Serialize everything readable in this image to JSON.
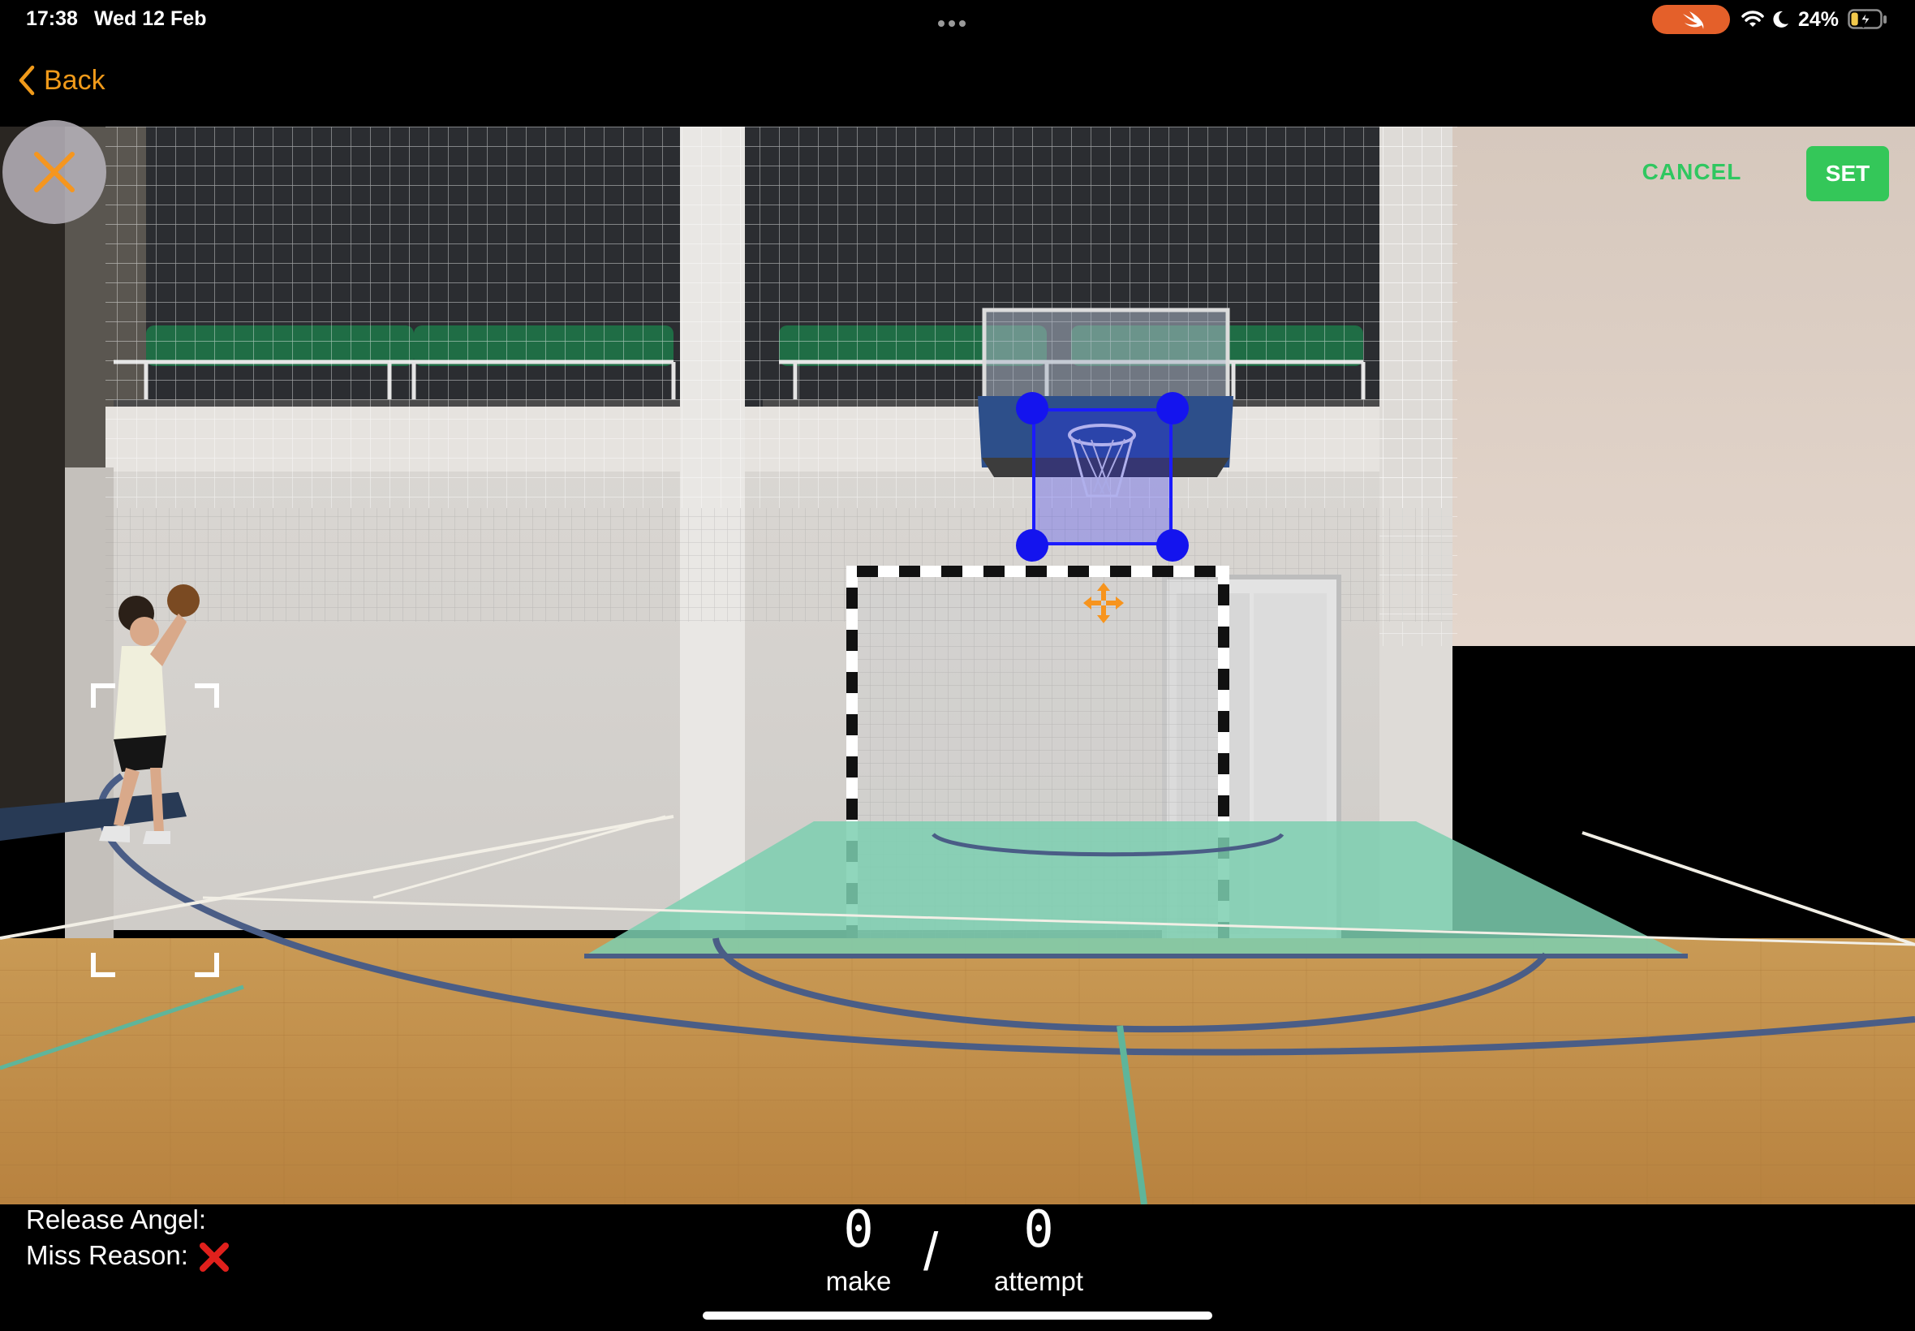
{
  "status_bar": {
    "time": "17:38",
    "date": "Wed 12 Feb",
    "battery_percent": "24%",
    "battery_level": 0.24,
    "charging": true,
    "swift_pill_color": "#e4602a"
  },
  "nav": {
    "back_label": "Back",
    "accent_color": "#f09a1a"
  },
  "overlay": {
    "cancel_label": "CANCEL",
    "set_label": "SET",
    "set_color": "#34c759",
    "hoop_box_color": "#1b1bff"
  },
  "stats": {
    "release_angle_label": "Release Angel:",
    "miss_reason_label": "Miss Reason:",
    "make_count": "0",
    "attempt_count": "0",
    "separator": "/",
    "make_label": "make",
    "attempt_label": "attempt"
  },
  "icons": {
    "close": "close-icon",
    "back": "chevron-left-icon",
    "move": "move-arrows-icon",
    "miss": "red-x-icon",
    "wifi": "wifi-icon",
    "moon": "moon-icon",
    "battery": "battery-charging-icon",
    "swift": "swift-icon"
  }
}
